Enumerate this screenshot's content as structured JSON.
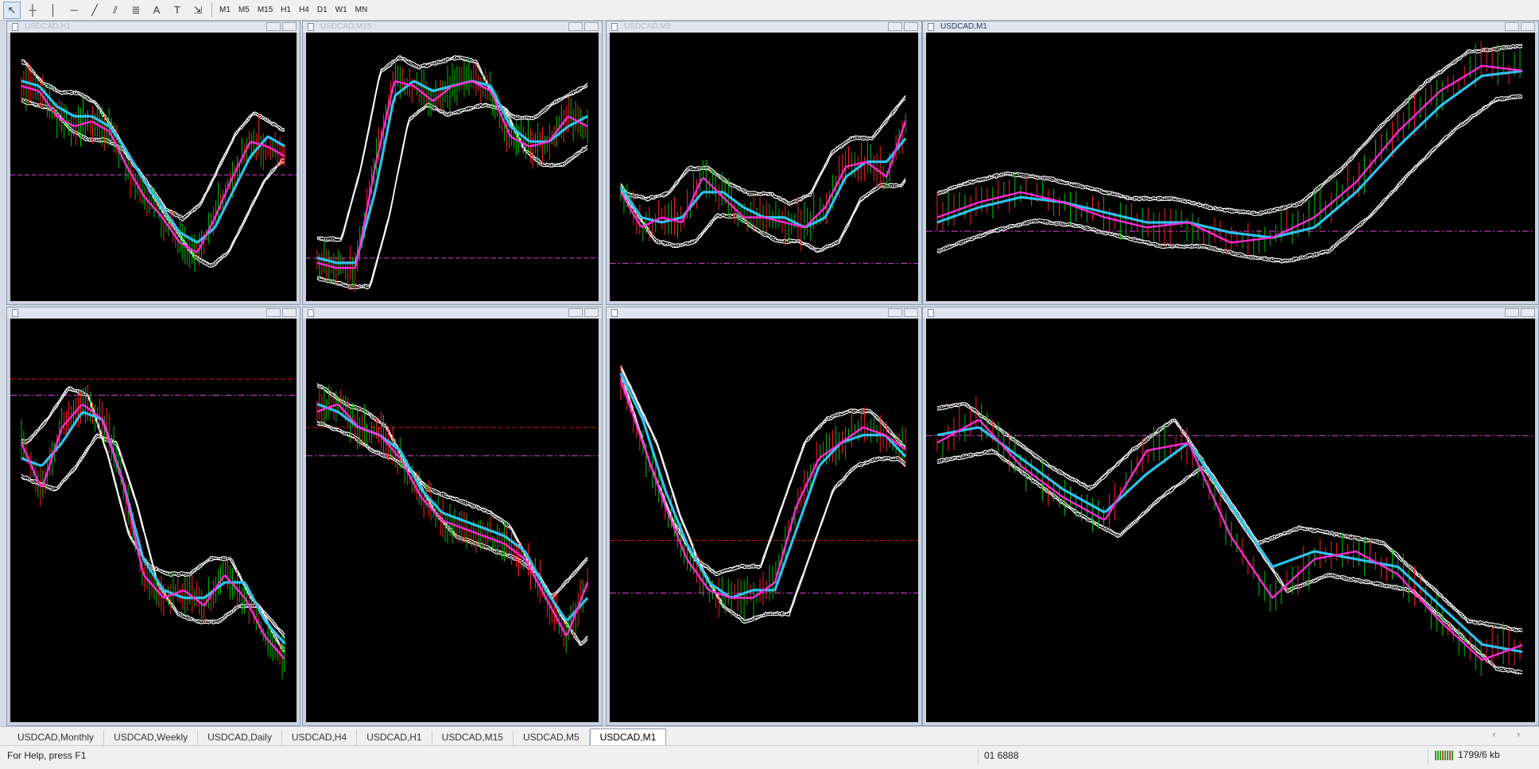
{
  "toolbar": {
    "tools": [
      {
        "icon": "cursor-arrow-icon",
        "glyph": "↖",
        "active": true
      },
      {
        "icon": "crosshair-icon",
        "glyph": "┼",
        "active": false
      },
      {
        "icon": "vertical-line-icon",
        "glyph": "│",
        "active": false
      },
      {
        "icon": "horizontal-line-icon",
        "glyph": "─",
        "active": false
      },
      {
        "icon": "trendline-icon",
        "glyph": "╱",
        "active": false
      },
      {
        "icon": "equidistant-channel-icon",
        "glyph": "⫽",
        "active": false
      },
      {
        "icon": "fibonacci-retracement-icon",
        "glyph": "≣",
        "active": false
      },
      {
        "icon": "text-icon",
        "glyph": "A",
        "active": false
      },
      {
        "icon": "text-label-icon",
        "glyph": "T",
        "active": false
      },
      {
        "icon": "arrows-dropdown-icon",
        "glyph": "⇲",
        "active": false
      }
    ],
    "timeframes": [
      "M1",
      "M5",
      "M15",
      "H1",
      "H4",
      "D1",
      "W1",
      "MN"
    ]
  },
  "charts": [
    {
      "title": "USDCAD,H1",
      "active": false
    },
    {
      "title": "USDCAD,M15",
      "active": false
    },
    {
      "title": "USDCAD,M5",
      "active": false
    },
    {
      "title": "USDCAD,M1",
      "active": true
    },
    {
      "title": "",
      "active": false
    },
    {
      "title": "",
      "active": false
    },
    {
      "title": "",
      "active": false
    },
    {
      "title": "",
      "active": false
    }
  ],
  "tabs": [
    "USDCAD,Monthly",
    "USDCAD,Weekly",
    "USDCAD,Daily",
    "USDCAD,H4",
    "USDCAD,H1",
    "USDCAD,M15",
    "USDCAD,M5",
    "USDCAD,M1"
  ],
  "active_tab": 7,
  "tab_arrows": "‹ ›",
  "status": {
    "help": "For Help, press F1",
    "price": "01 6888",
    "connection": "1799/6 kb"
  },
  "colors": {
    "chart_bg": "#000000",
    "up_candle": "#00c000",
    "down_candle": "#ff2020",
    "ma_fast": "#ff2bd6",
    "ma_slow": "#2ec3ee",
    "envelope": "#ffffff",
    "level_red": "#d01818",
    "level_magenta": "#e040e0"
  },
  "chart_data": [
    {
      "type": "line",
      "series": [
        {
          "values": [
            82,
            80,
            70,
            66,
            68,
            64,
            50,
            38,
            30,
            20,
            16,
            30,
            46,
            60,
            58,
            54
          ]
        },
        {
          "values": [
            84,
            82,
            74,
            70,
            70,
            66,
            56,
            44,
            34,
            24,
            20,
            26,
            40,
            54,
            62,
            58
          ]
        }
      ]
    },
    {
      "type": "line",
      "series": [
        {
          "values": [
            12,
            10,
            10,
            50,
            84,
            82,
            76,
            82,
            84,
            80,
            62,
            58,
            60,
            70,
            66
          ]
        },
        {
          "values": [
            14,
            12,
            12,
            40,
            78,
            84,
            80,
            82,
            84,
            82,
            66,
            60,
            60,
            66,
            70
          ]
        }
      ]
    },
    {
      "type": "line",
      "series": [
        {
          "values": [
            40,
            26,
            30,
            28,
            46,
            38,
            30,
            30,
            28,
            26,
            34,
            50,
            52,
            46,
            70
          ]
        },
        {
          "values": [
            42,
            30,
            28,
            30,
            40,
            40,
            34,
            30,
            30,
            26,
            30,
            46,
            52,
            52,
            62
          ]
        }
      ]
    },
    {
      "type": "line",
      "series": [
        {
          "values": [
            30,
            36,
            40,
            36,
            30,
            26,
            28,
            20,
            22,
            30,
            44,
            64,
            80,
            90,
            88
          ]
        },
        {
          "values": [
            28,
            34,
            38,
            36,
            32,
            28,
            28,
            24,
            22,
            26,
            40,
            58,
            74,
            86,
            88
          ]
        }
      ]
    },
    {
      "type": "line",
      "series": [
        {
          "values": [
            70,
            58,
            74,
            80,
            76,
            60,
            36,
            30,
            32,
            28,
            36,
            30,
            20,
            14
          ]
        },
        {
          "values": [
            66,
            64,
            70,
            78,
            76,
            60,
            40,
            32,
            30,
            30,
            34,
            34,
            24,
            18
          ]
        }
      ]
    },
    {
      "type": "line",
      "series": [
        {
          "values": [
            78,
            80,
            74,
            72,
            66,
            56,
            50,
            48,
            46,
            44,
            40,
            30,
            20,
            34
          ]
        },
        {
          "values": [
            80,
            78,
            74,
            72,
            68,
            58,
            52,
            50,
            48,
            46,
            42,
            32,
            24,
            30
          ]
        }
      ]
    },
    {
      "type": "line",
      "series": [
        {
          "values": [
            86,
            70,
            54,
            40,
            32,
            30,
            30,
            34,
            54,
            66,
            70,
            74,
            72,
            68
          ]
        },
        {
          "values": [
            88,
            76,
            58,
            44,
            34,
            30,
            32,
            32,
            48,
            64,
            70,
            72,
            72,
            66
          ]
        }
      ]
    },
    {
      "type": "line",
      "series": [
        {
          "values": [
            70,
            76,
            64,
            56,
            50,
            68,
            70,
            46,
            30,
            40,
            42,
            36,
            24,
            14,
            18
          ]
        },
        {
          "values": [
            72,
            74,
            66,
            58,
            52,
            62,
            70,
            54,
            38,
            42,
            40,
            38,
            28,
            18,
            16
          ]
        }
      ]
    }
  ]
}
